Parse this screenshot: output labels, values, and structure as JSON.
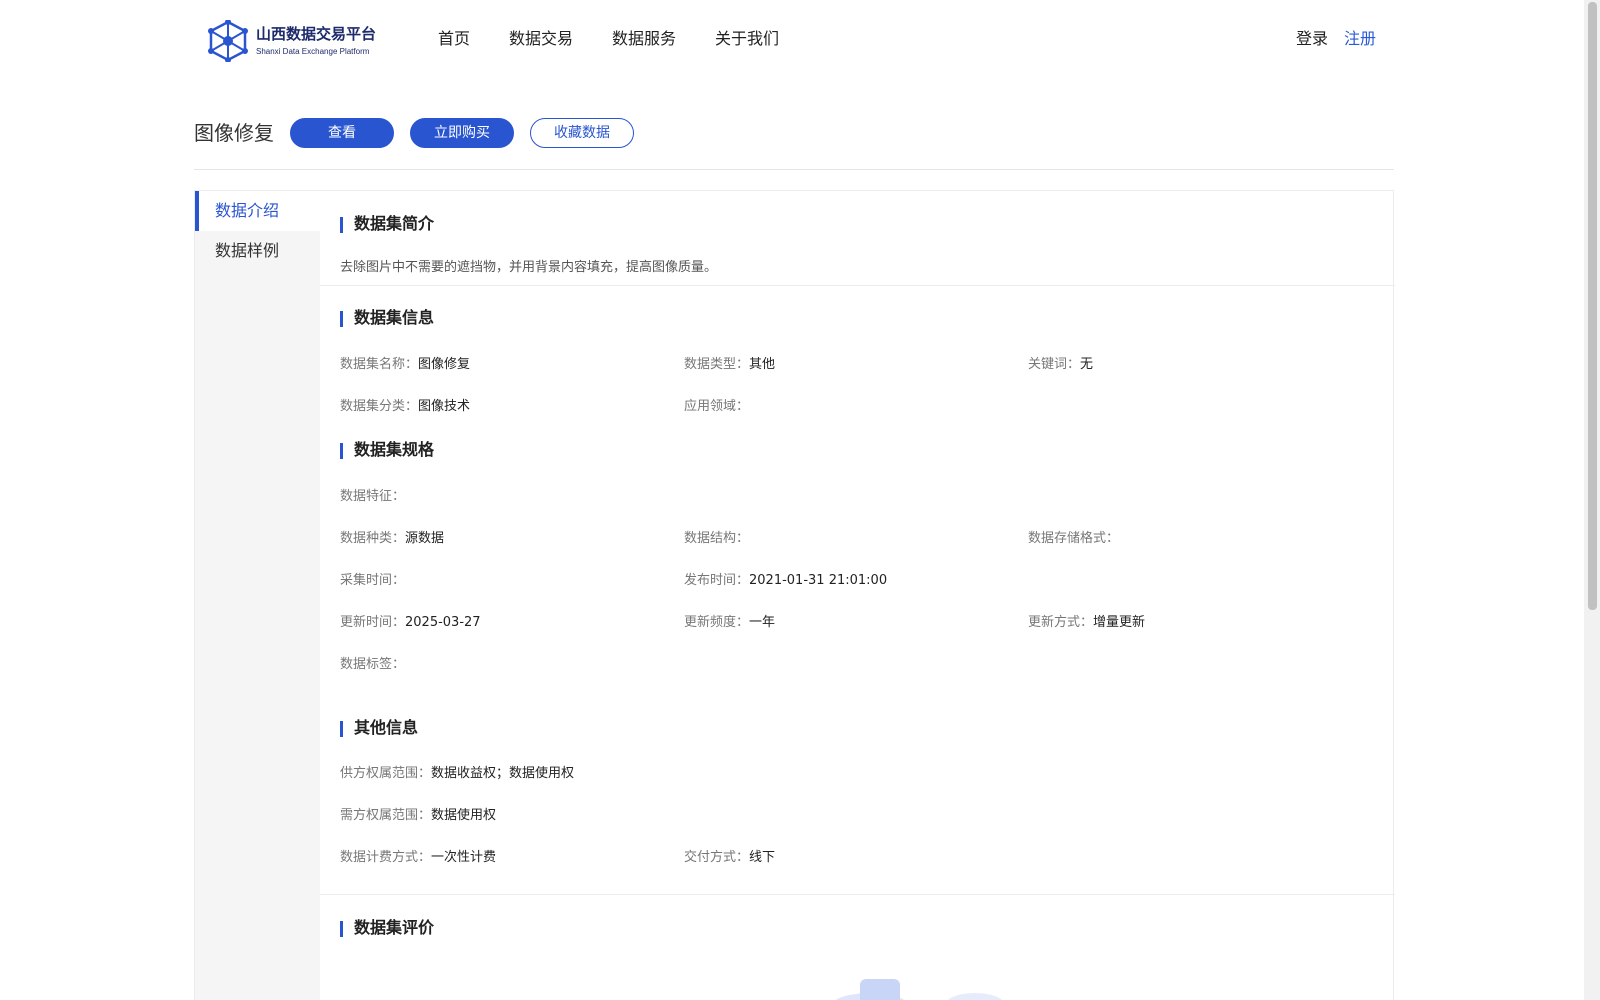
{
  "brand": {
    "title": "山西数据交易平台",
    "subtitle": "Shanxi Data Exchange Platform",
    "color": "#2a55d0"
  },
  "nav": {
    "items": [
      "首页",
      "数据交易",
      "数据服务",
      "关于我们"
    ]
  },
  "auth": {
    "login": "登录",
    "register": "注册"
  },
  "titlebar": {
    "title": "图像修复",
    "view_button": "查看",
    "buy_button": "立即购买",
    "favorite_button": "收藏数据"
  },
  "sidebar": {
    "items": [
      "数据介绍",
      "数据样例"
    ],
    "active": "数据介绍"
  },
  "intro": {
    "heading": "数据集简介",
    "text": "去除图片中不需要的遮挡物，并用背景内容填充，提高图像质量。"
  },
  "info": {
    "heading": "数据集信息",
    "fields": [
      {
        "label": "数据集名称：",
        "value": "图像修复"
      },
      {
        "label": "数据类型：",
        "value": "其他"
      },
      {
        "label": "关键词：",
        "value": "无"
      },
      {
        "label": "数据集分类：",
        "value": "图像技术"
      },
      {
        "label": "应用领域：",
        "value": ""
      }
    ]
  },
  "spec": {
    "heading": "数据集规格",
    "fields": [
      {
        "label": "数据特征：",
        "value": ""
      },
      {
        "label": "数据种类：",
        "value": "源数据"
      },
      {
        "label": "数据结构：",
        "value": ""
      },
      {
        "label": "数据存储格式：",
        "value": ""
      },
      {
        "label": "采集时间：",
        "value": ""
      },
      {
        "label": "发布时间：",
        "value": "2021-01-31 21:01:00"
      },
      {
        "label": "更新时间：",
        "value": "2025-03-27"
      },
      {
        "label": "更新频度：",
        "value": "一年"
      },
      {
        "label": "更新方式：",
        "value": "增量更新"
      },
      {
        "label": "数据标签：",
        "value": ""
      }
    ]
  },
  "other": {
    "heading": "其他信息",
    "fields": [
      {
        "label": "供方权属范围：",
        "value": "数据收益权；数据使用权"
      },
      {
        "label": "需方权属范围：",
        "value": "数据使用权"
      },
      {
        "label": "数据计费方式：",
        "value": "一次性计费"
      },
      {
        "label": "交付方式：",
        "value": "线下"
      }
    ]
  },
  "review": {
    "heading": "数据集评价"
  }
}
